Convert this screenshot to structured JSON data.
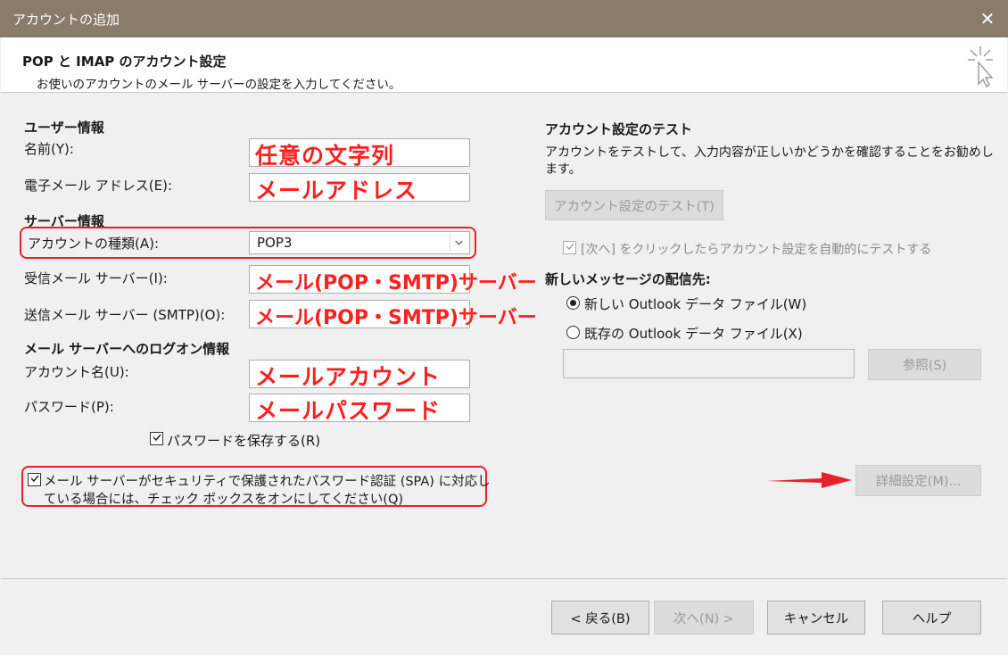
{
  "window": {
    "title": "アカウントの追加",
    "close_symbol": "✕"
  },
  "header": {
    "title": "POP と IMAP のアカウント設定",
    "subtitle": "お使いのアカウントのメール サーバーの設定を入力してください。"
  },
  "user_info": {
    "section_label": "ユーザー情報",
    "name_label": "名前(Y):",
    "name_value": "任意の文字列",
    "email_label": "電子メール アドレス(E):",
    "email_value": "メールアドレス"
  },
  "server_info": {
    "section_label": "サーバー情報",
    "account_type_label": "アカウントの種類(A):",
    "account_type_value": "POP3",
    "incoming_label": "受信メール サーバー(I):",
    "incoming_value": "メール(POP・SMTP)サーバー",
    "outgoing_label": "送信メール サーバー (SMTP)(O):",
    "outgoing_value": "メール(POP・SMTP)サーバー"
  },
  "logon_info": {
    "section_label": "メール サーバーへのログオン情報",
    "account_name_label": "アカウント名(U):",
    "account_name_value": "メールアカウント",
    "password_label": "パスワード(P):",
    "password_value": "メールパスワード",
    "save_password_label": "パスワードを保存する(R)",
    "spa_label_line1": "メール サーバーがセキュリティで保護されたパスワード認証 (SPA) に対応し",
    "spa_label_line2": "ている場合には、チェック ボックスをオンにしてください(Q)"
  },
  "test": {
    "section_label": "アカウント設定のテスト",
    "description_line1": "アカウントをテストして、入力内容が正しいかどうかを確認することをお勧めし",
    "description_line2": "ます。",
    "test_button": "アカウント設定のテスト(T)",
    "auto_test_label": "[次へ] をクリックしたらアカウント設定を自動的にテストする"
  },
  "delivery": {
    "section_label": "新しいメッセージの配信先:",
    "option_new": "新しい Outlook データ ファイル(W)",
    "option_existing": "既存の Outlook データ ファイル(X)",
    "browse_button": "参照(S)"
  },
  "advanced_button": "詳細設定(M)...",
  "footer": {
    "back": "< 戻る(B)",
    "next": "次へ(N) >",
    "cancel": "キャンセル",
    "help": "ヘルプ"
  },
  "colors": {
    "annotation_red": "#e8202a",
    "titlebar": "#8a7c6a"
  }
}
